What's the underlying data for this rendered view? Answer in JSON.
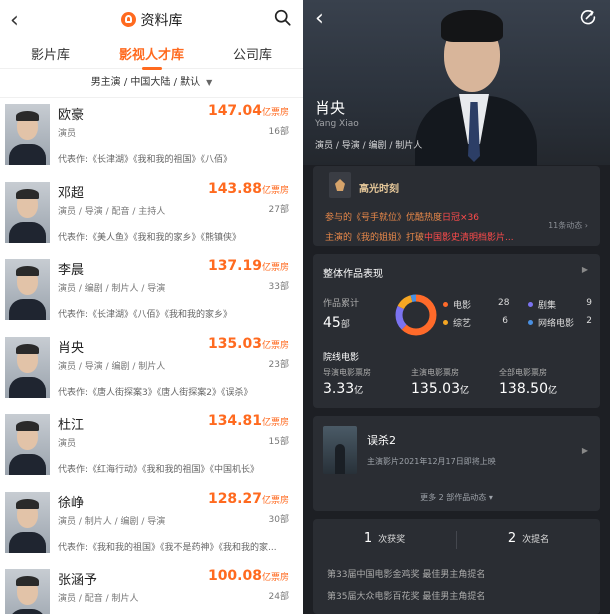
{
  "left": {
    "title": "资料库",
    "tabs": [
      {
        "label": "影片库",
        "active": false
      },
      {
        "label": "影视人才库",
        "active": true
      },
      {
        "label": "公司库",
        "active": false
      }
    ],
    "filter_text": "男主演 / 中国大陆 / 默认",
    "accent_color": "#ff6a1f",
    "people": [
      {
        "name": "欧豪",
        "roles": "演员",
        "box": "147.04",
        "box_unit": "亿票房",
        "count": "16部",
        "works": "代表作:《长津湖》《我和我的祖国》《八佰》"
      },
      {
        "name": "邓超",
        "roles": "演员 / 导演 / 配音 / 主持人",
        "box": "143.88",
        "box_unit": "亿票房",
        "count": "27部",
        "works": "代表作:《美人鱼》《我和我的家乡》《熊镇侠》"
      },
      {
        "name": "李晨",
        "roles": "演员 / 编剧 / 制片人 / 导演",
        "box": "137.19",
        "box_unit": "亿票房",
        "count": "33部",
        "works": "代表作:《长津湖》《八佰》《我和我的家乡》"
      },
      {
        "name": "肖央",
        "roles": "演员 / 导演 / 编剧 / 制片人",
        "box": "135.03",
        "box_unit": "亿票房",
        "count": "23部",
        "works": "代表作:《唐人街探案3》《唐人街探案2》《误杀》"
      },
      {
        "name": "杜江",
        "roles": "演员",
        "box": "134.81",
        "box_unit": "亿票房",
        "count": "15部",
        "works": "代表作:《红海行动》《我和我的祖国》《中国机长》"
      },
      {
        "name": "徐峥",
        "roles": "演员 / 制片人 / 编剧 / 导演",
        "box": "128.27",
        "box_unit": "亿票房",
        "count": "30部",
        "works": "代表作:《我和我的祖国》《我不是药神》《我和我的家..."
      },
      {
        "name": "张涵予",
        "roles": "演员 / 配音 / 制片人",
        "box": "100.08",
        "box_unit": "亿票房",
        "count": "24部",
        "works": ""
      }
    ]
  },
  "right": {
    "name": "肖央",
    "en_name": "Yang Xiao",
    "roles": "演员 / 导演 / 编剧 / 制片人",
    "highlight": {
      "title": "高光时刻",
      "line1_a": "参与的《号手就位》优酷热度",
      "line1_b": "日冠×36",
      "line2_a": "主演的《我的姐姐》打破",
      "line2_b": "中国影史清明档影片...",
      "more": "11条动态"
    },
    "overall": {
      "title": "整体作品表现",
      "cum_label": "作品累计",
      "cum_value": "45",
      "cum_unit": "部",
      "legend": [
        {
          "label": "电影",
          "value": "28",
          "color": "#ff6a2a"
        },
        {
          "label": "剧集",
          "value": "9",
          "color": "#7b73f0"
        },
        {
          "label": "综艺",
          "value": "6",
          "color": "#f5a623"
        },
        {
          "label": "网络电影",
          "value": "2",
          "color": "#4a90e2"
        }
      ],
      "theater_label": "院线电影",
      "stats": [
        {
          "label": "导演电影票房",
          "value": "3.33",
          "unit": "亿"
        },
        {
          "label": "主演电影票房",
          "value": "135.03",
          "unit": "亿"
        },
        {
          "label": "全部电影票房",
          "value": "138.50",
          "unit": "亿"
        }
      ]
    },
    "film": {
      "title": "误杀2",
      "subtitle": "主演影片2021年12月17日即将上映",
      "more": "更多 2 部作品动态"
    },
    "awards": {
      "win_count": "1",
      "win_label": "次获奖",
      "nom_count": "2",
      "nom_label": "次提名",
      "items": [
        "第33届中国电影金鸡奖 最佳男主角提名",
        "第35届大众电影百花奖 最佳男主角提名"
      ]
    }
  }
}
